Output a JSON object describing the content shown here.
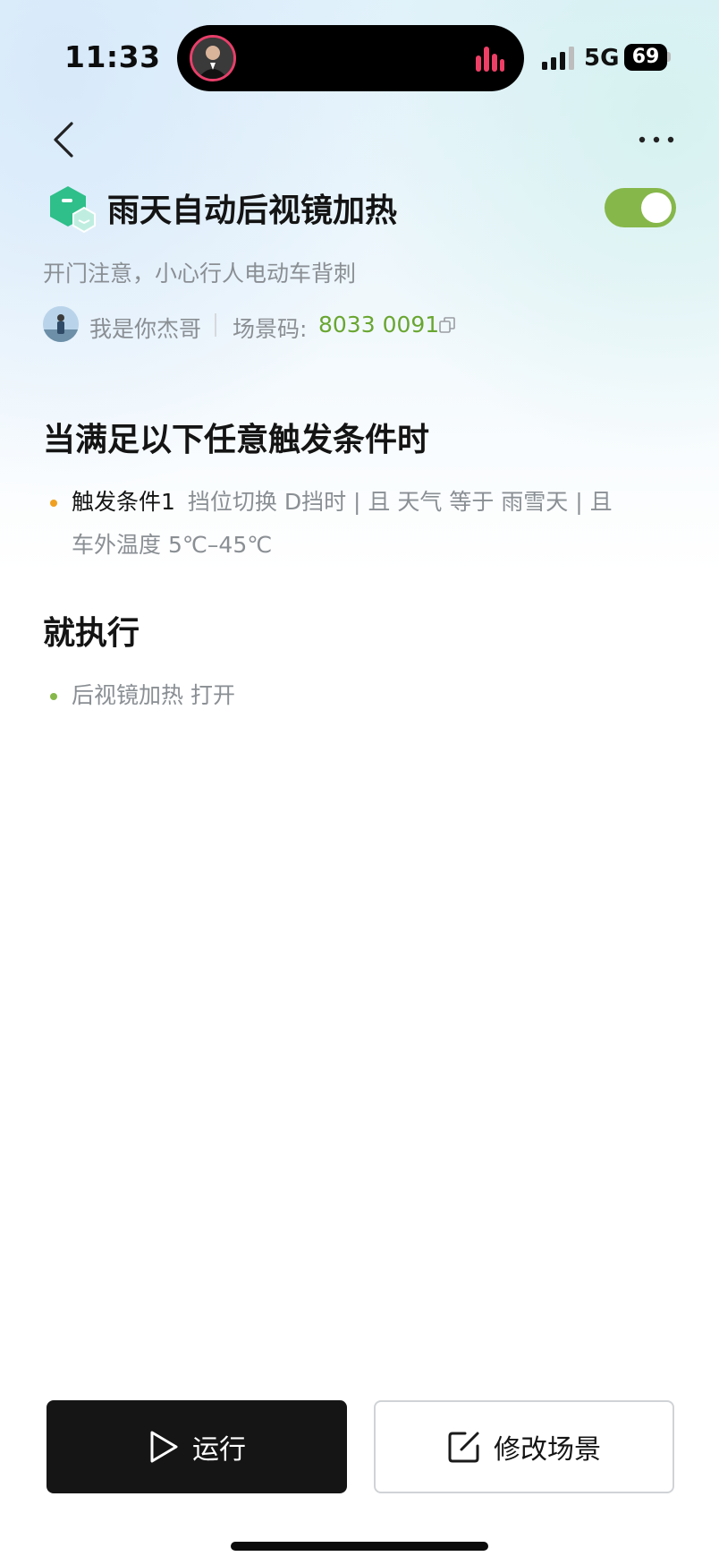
{
  "status_bar": {
    "time": "11:33",
    "network": "5G",
    "battery": "69"
  },
  "nav": {
    "back_icon": "chevron-left-icon",
    "more_icon": "more-horizontal-icon"
  },
  "scene": {
    "title": "雨天自动后视镜加热",
    "subtitle": "开门注意，小心行人电动车背刺",
    "enabled": true,
    "icon": "scene-cube-icon",
    "colors": {
      "toggle_on": "#86b74a",
      "code": "#69a631",
      "icon": "#2fbf8a"
    }
  },
  "author": {
    "name": "我是你杰哥",
    "code_label": "场景码:",
    "code_value": "8033 0091"
  },
  "conditions": {
    "heading": "当满足以下任意触发条件时",
    "items": [
      {
        "name": "触发条件1",
        "detail_line1": "挡位切换 D挡时 | 且 天气 等于 雨雪天 | 且",
        "detail_line2": "车外温度 5℃–45℃"
      }
    ]
  },
  "actions": {
    "heading": "就执行",
    "items": [
      {
        "text": "后视镜加热 打开"
      }
    ]
  },
  "buttons": {
    "run_label": "运行",
    "edit_label": "修改场景"
  }
}
